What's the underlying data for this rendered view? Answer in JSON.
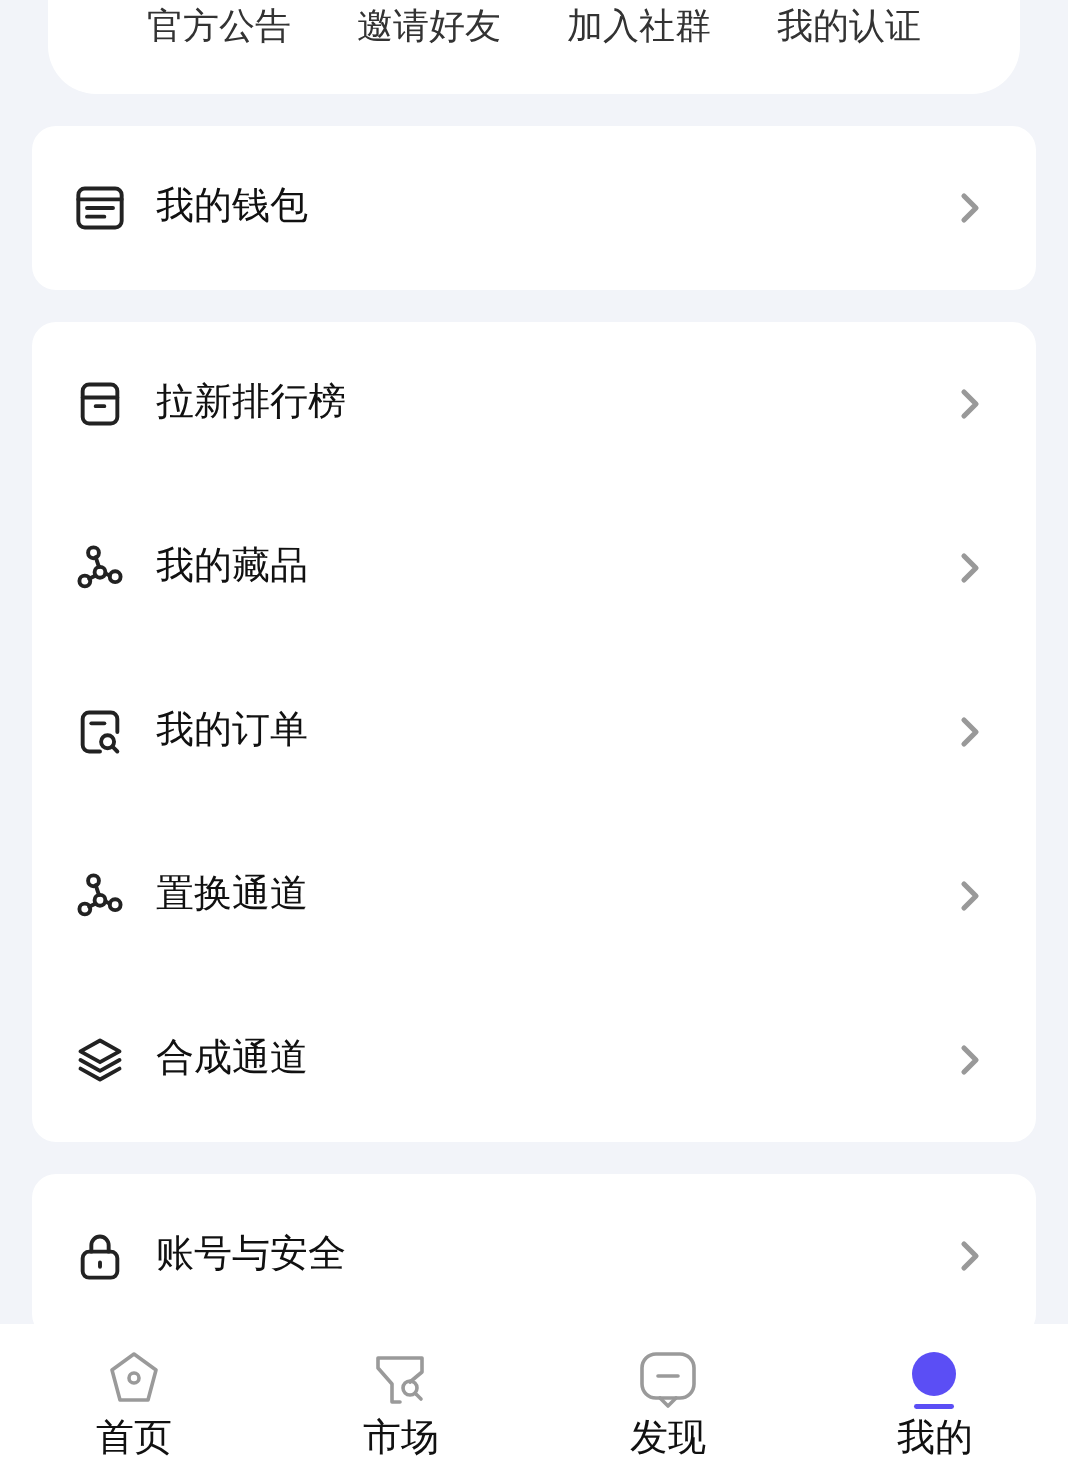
{
  "quick_links": [
    "官方公告",
    "邀请好友",
    "加入社群",
    "我的认证"
  ],
  "menu_groups": [
    {
      "items": [
        "我的钱包"
      ]
    },
    {
      "items": [
        "拉新排行榜",
        "我的藏品",
        "我的订单",
        "置换通道",
        "合成通道"
      ]
    },
    {
      "items": [
        "账号与安全"
      ]
    }
  ],
  "bottom_nav": [
    {
      "label": "首页",
      "selected": false
    },
    {
      "label": "市场",
      "selected": false
    },
    {
      "label": "发现",
      "selected": false
    },
    {
      "label": "我的",
      "selected": true
    }
  ]
}
